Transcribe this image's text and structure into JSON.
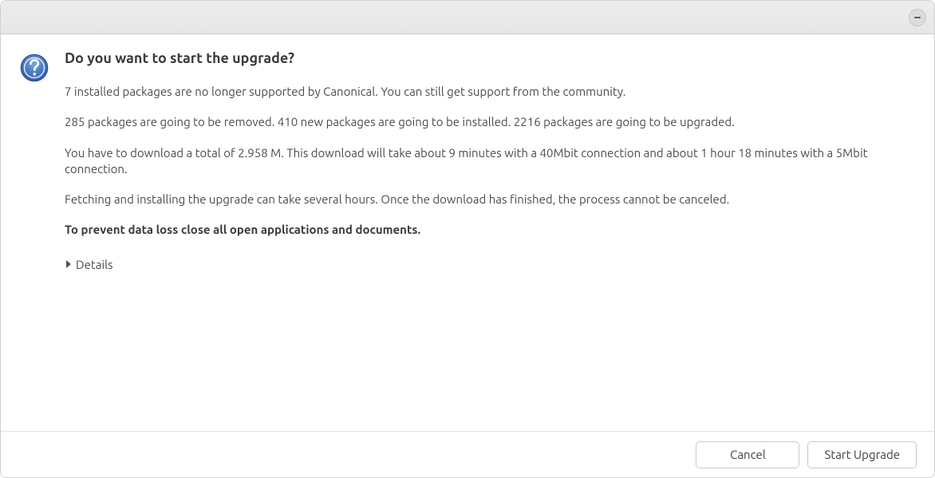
{
  "dialog": {
    "heading": "Do you want to start the upgrade?",
    "paragraphs": {
      "unsupported": "7 installed packages are no longer supported by Canonical. You can still get support from the community.",
      "changes": "285 packages are going to be removed. 410 new packages are going to be installed. 2216 packages are going to be upgraded.",
      "download": "You have to download a total of 2.958 M. This download will take about 9 minutes with a 40Mbit connection and about 1 hour 18 minutes with a 5Mbit connection.",
      "warning_time": "Fetching and installing the upgrade can take several hours. Once the download has finished, the process cannot be canceled.",
      "data_loss": "To prevent data loss close all open applications and documents."
    },
    "details_label": "Details"
  },
  "buttons": {
    "cancel": "Cancel",
    "start": "Start Upgrade"
  }
}
